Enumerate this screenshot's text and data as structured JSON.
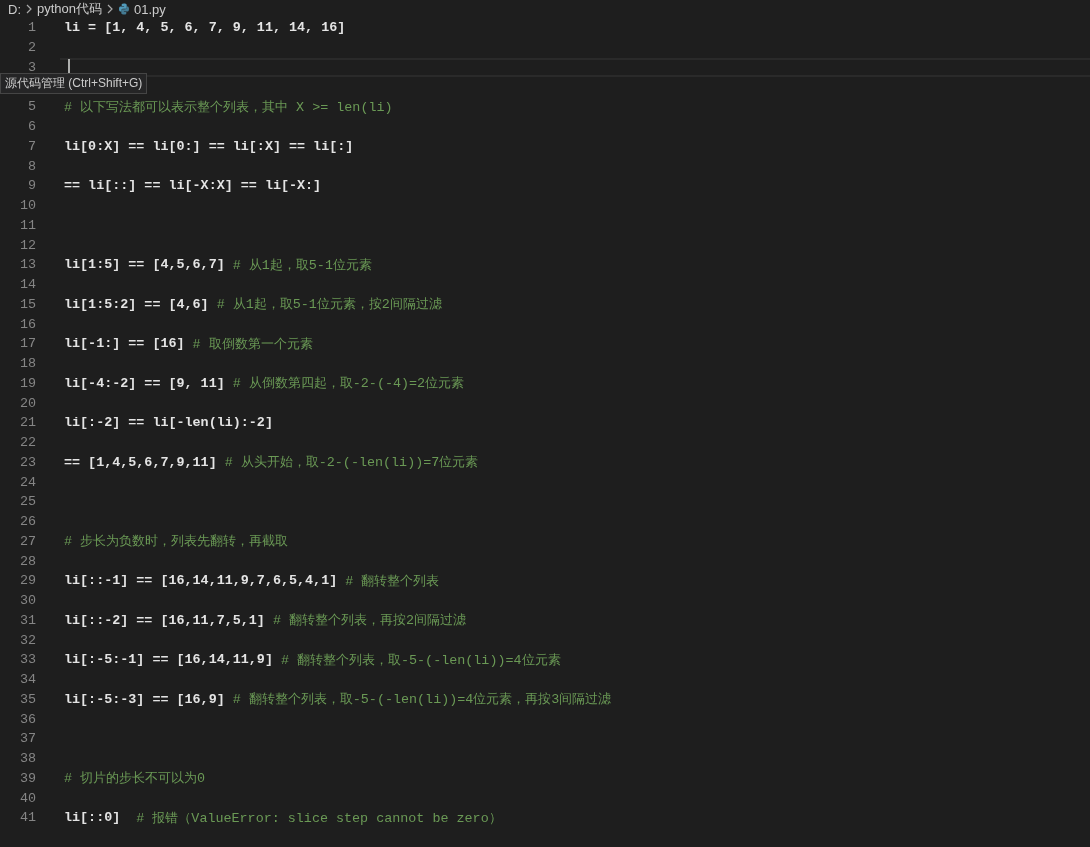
{
  "breadcrumb": [
    {
      "label": "D:",
      "kind": "folder"
    },
    {
      "label": "python代码",
      "kind": "folder"
    },
    {
      "label": "01.py",
      "kind": "file"
    }
  ],
  "tooltip": "源代码管理 (Ctrl+Shift+G)",
  "lines": [
    {
      "number": "1",
      "code": "li = [1, 4, 5, 6, 7, 9, 11, 14, 16]",
      "cursor": false
    },
    {
      "number": "2",
      "cursor": false
    },
    {
      "number": "3",
      "cursor": true
    },
    {
      "cursor": false
    },
    {
      "number": "5",
      "comment": "# 以下写法都可以表示整个列表，其中 X >= len(li)",
      "cursor": false
    },
    {
      "number": "6",
      "cursor": false
    },
    {
      "number": "7",
      "code": "li[0:X] == li[0:] == li[:X] == li[:]",
      "cursor": false
    },
    {
      "number": "8",
      "cursor": false
    },
    {
      "number": "9",
      "code": "== li[::] == li[-X:X] == li[-X:]",
      "cursor": false
    },
    {
      "number": "10",
      "cursor": false
    },
    {
      "number": "11",
      "cursor": false
    },
    {
      "number": "12",
      "cursor": false
    },
    {
      "number": "13",
      "code": "li[1:5] == [4,5,6,7]",
      "comment": "# 从1起，取5-1位元素",
      "cursor": false
    },
    {
      "number": "14",
      "cursor": false
    },
    {
      "number": "15",
      "code": "li[1:5:2] == [4,6]",
      "comment": "# 从1起，取5-1位元素，按2间隔过滤",
      "cursor": false
    },
    {
      "number": "16",
      "cursor": false
    },
    {
      "number": "17",
      "code": "li[-1:] == [16]",
      "comment": "# 取倒数第一个元素",
      "cursor": false
    },
    {
      "number": "18",
      "cursor": false
    },
    {
      "number": "19",
      "code": "li[-4:-2] == [9, 11]",
      "comment": "# 从倒数第四起，取-2-(-4)=2位元素",
      "cursor": false
    },
    {
      "number": "20",
      "cursor": false
    },
    {
      "number": "21",
      "code": "li[:-2] == li[-len(li):-2]",
      "cursor": false
    },
    {
      "number": "22",
      "cursor": false
    },
    {
      "number": "23",
      "code": "== [1,4,5,6,7,9,11]",
      "comment": "# 从头开始，取-2-(-len(li))=7位元素",
      "cursor": false
    },
    {
      "number": "24",
      "cursor": false
    },
    {
      "number": "25",
      "cursor": false
    },
    {
      "number": "26",
      "cursor": false
    },
    {
      "number": "27",
      "comment": "# 步长为负数时，列表先翻转，再截取",
      "cursor": false
    },
    {
      "number": "28",
      "cursor": false
    },
    {
      "number": "29",
      "code": "li[::-1] == [16,14,11,9,7,6,5,4,1]",
      "comment": "# 翻转整个列表",
      "cursor": false
    },
    {
      "number": "30",
      "cursor": false
    },
    {
      "number": "31",
      "code": "li[::-2] == [16,11,7,5,1]",
      "comment": "# 翻转整个列表，再按2间隔过滤",
      "cursor": false
    },
    {
      "number": "32",
      "cursor": false
    },
    {
      "number": "33",
      "code": "li[:-5:-1] == [16,14,11,9]",
      "comment": "# 翻转整个列表，取-5-(-len(li))=4位元素",
      "cursor": false
    },
    {
      "number": "34",
      "cursor": false
    },
    {
      "number": "35",
      "code": "li[:-5:-3] == [16,9]",
      "comment": "# 翻转整个列表，取-5-(-len(li))=4位元素，再按3间隔过滤",
      "cursor": false
    },
    {
      "number": "36",
      "cursor": false
    },
    {
      "number": "37",
      "cursor": false
    },
    {
      "number": "38",
      "cursor": false
    },
    {
      "number": "39",
      "comment": "# 切片的步长不可以为0",
      "cursor": false
    },
    {
      "number": "40",
      "cursor": false
    },
    {
      "number": "41",
      "code": "li[::0]",
      "comment": " # 报错（ValueError: slice step cannot be zero）",
      "cursor": false
    }
  ]
}
